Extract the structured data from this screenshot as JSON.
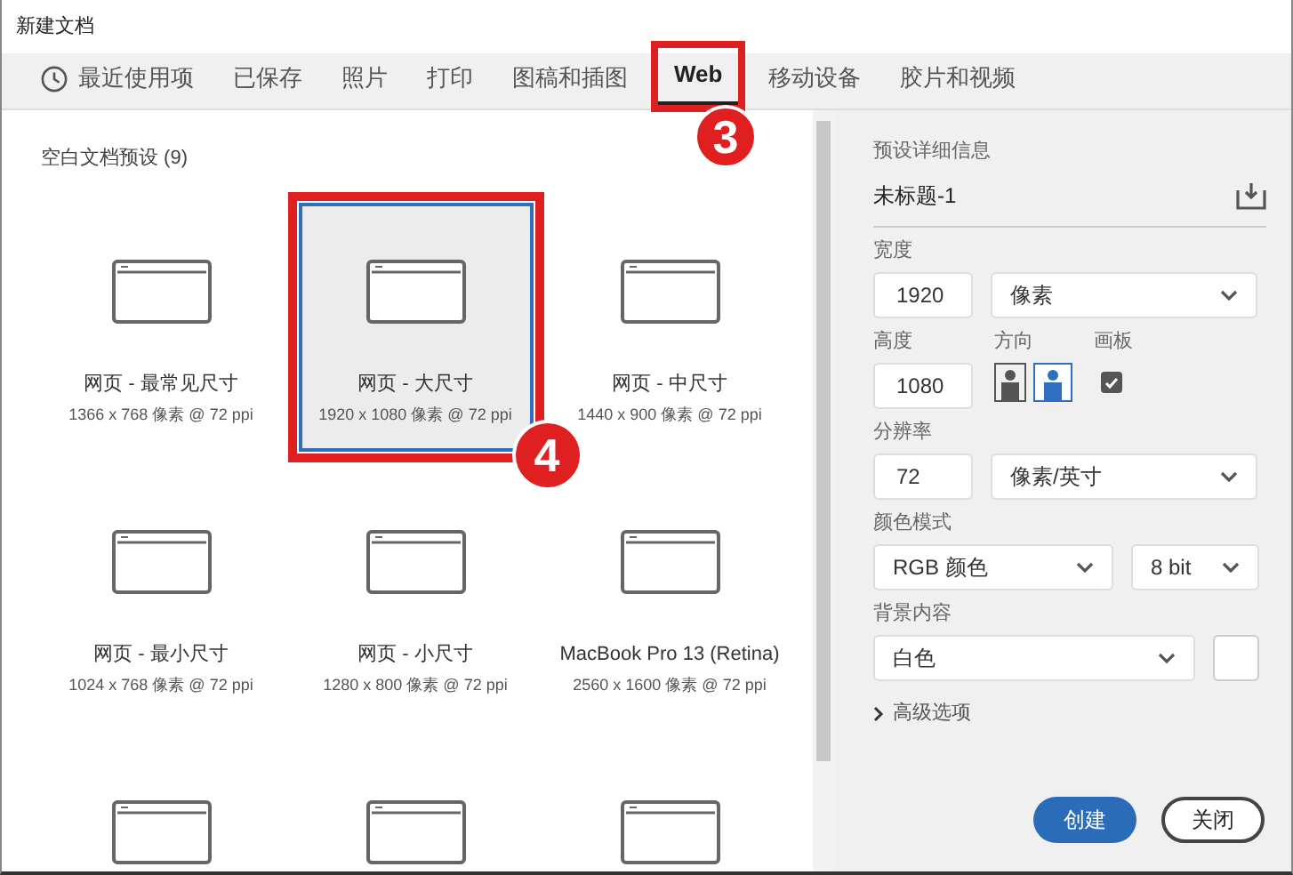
{
  "window": {
    "title": "新建文档"
  },
  "tabs": [
    {
      "label": "最近使用项",
      "selected": false,
      "kind": "recent"
    },
    {
      "label": "已保存",
      "selected": false
    },
    {
      "label": "照片",
      "selected": false
    },
    {
      "label": "打印",
      "selected": false
    },
    {
      "label": "图稿和插图",
      "selected": false
    },
    {
      "label": "Web",
      "selected": true,
      "callout": "3"
    },
    {
      "label": "移动设备",
      "selected": false
    },
    {
      "label": "胶片和视频",
      "selected": false
    }
  ],
  "presets_heading": "空白文档预设 (9)",
  "presets": [
    {
      "name": "网页 - 最常见尺寸",
      "size": "1366 x 768 像素 @ 72 ppi",
      "selected": false
    },
    {
      "name": "网页 - 大尺寸",
      "size": "1920 x 1080 像素 @ 72 ppi",
      "selected": true,
      "callout": "4"
    },
    {
      "name": "网页 - 中尺寸",
      "size": "1440 x 900 像素 @ 72 ppi",
      "selected": false
    },
    {
      "name": "网页 - 最小尺寸",
      "size": "1024 x 768 像素 @ 72 ppi",
      "selected": false
    },
    {
      "name": "网页 - 小尺寸",
      "size": "1280 x 800 像素 @ 72 ppi",
      "selected": false
    },
    {
      "name": "MacBook Pro 13 (Retina)",
      "size": "2560 x 1600 像素 @ 72 ppi",
      "selected": false
    },
    {
      "selected": false
    },
    {
      "selected": false
    },
    {
      "selected": false
    }
  ],
  "details": {
    "heading": "预设详细信息",
    "doc_name": "未标题-1",
    "width": {
      "label": "宽度",
      "value": "1920",
      "unit": "像素"
    },
    "height": {
      "label": "高度",
      "value": "1080"
    },
    "orientation": {
      "label": "方向",
      "options": [
        {
          "kind": "portrait",
          "selected": false
        },
        {
          "kind": "landscape",
          "selected": true
        }
      ]
    },
    "artboard": {
      "label": "画板",
      "checked": true
    },
    "resolution": {
      "label": "分辨率",
      "value": "72",
      "unit": "像素/英寸"
    },
    "color_mode": {
      "label": "颜色模式",
      "mode": "RGB 颜色",
      "depth": "8 bit"
    },
    "background": {
      "label": "背景内容",
      "value": "白色"
    },
    "advanced": {
      "label": "高级选项",
      "expanded": false
    }
  },
  "buttons": [
    {
      "label": "创建",
      "kind": "primary"
    },
    {
      "label": "关闭",
      "kind": "secondary"
    }
  ]
}
